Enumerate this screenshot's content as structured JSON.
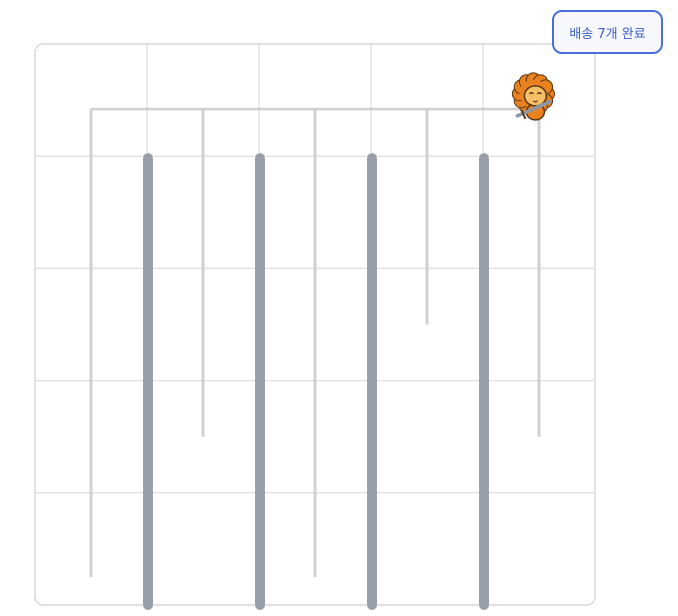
{
  "status": {
    "label": "배송 7개 완료"
  },
  "board": {
    "columns": 5,
    "rows": 5,
    "border_color": "#d8d8d8",
    "grid_color": "#e2e2e2",
    "track_color": "#d0d0d0",
    "pipe_color": "#97a0a8",
    "pipe_tracks": [
      1,
      2,
      3,
      4
    ],
    "thin_tracks": [
      {
        "pos": 0.5,
        "end_row": 4.75
      },
      {
        "pos": 1.5,
        "end_row": 3.5
      },
      {
        "pos": 2.5,
        "end_row": 4.75
      },
      {
        "pos": 3.5,
        "end_row": 2.5
      },
      {
        "pos": 4.5,
        "end_row": 3.5
      }
    ]
  },
  "player": {
    "character": "lion-knight-icon",
    "cell": {
      "col": 4,
      "row": 0
    },
    "colors": {
      "mane": "#e9821e",
      "face": "#f3bf67",
      "outline": "#5b3414",
      "sword": "#8e97a3"
    }
  }
}
